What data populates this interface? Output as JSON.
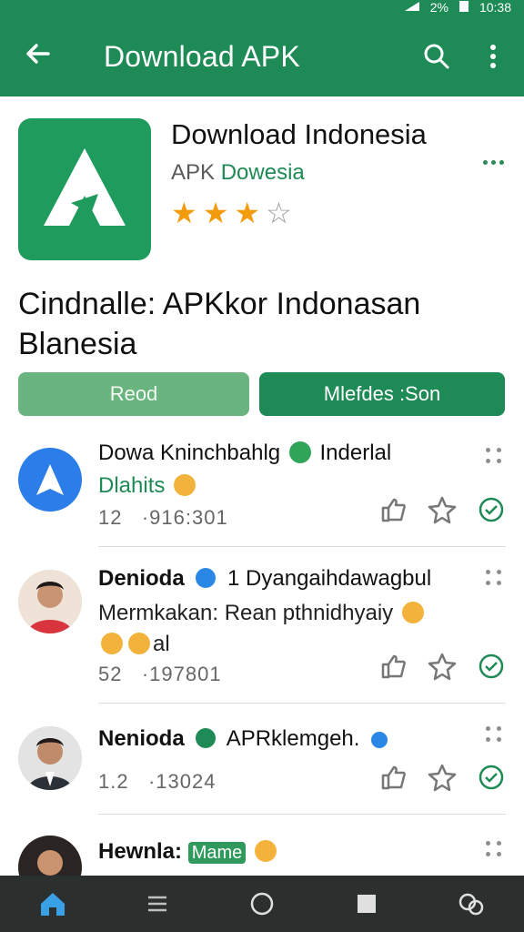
{
  "status_bar": {
    "battery": "2%",
    "time": "10:38"
  },
  "app_bar": {
    "title": "Download APK"
  },
  "app": {
    "name": "Download Indonesia",
    "subtitle_prefix": "APK ",
    "subtitle_highlight": "Dowesia",
    "rating": 3,
    "rating_max": 5
  },
  "headline": "Cindnalle: APKkor Indonasan Blanesia",
  "buttons": {
    "primary_label": "Reod",
    "secondary_label": "Mlefdes :Son"
  },
  "list": [
    {
      "title": "Dowa Kninchbahlg",
      "title_suffix": "Inderlal",
      "subtitle": "Dlahits",
      "meta_left": "12",
      "meta_right": "·916:301"
    },
    {
      "title": "Denioda",
      "title_suffix": "1 Dyangaihdawagbul",
      "subtitle": "Mermkakan: Rean pthnidhyaiy",
      "subtitle2": "al",
      "meta_left": "52",
      "meta_right": "·197801"
    },
    {
      "title": "Nenioda",
      "title_suffix": "APRklemgeh.",
      "meta_left": "1.2",
      "meta_right": "·13024"
    },
    {
      "title": "Hewnla:",
      "title_suffix": "Mame"
    }
  ],
  "colors": {
    "brand": "#1e8a55",
    "star": "#f29b0d",
    "nav_bg": "#2b2f2d"
  }
}
